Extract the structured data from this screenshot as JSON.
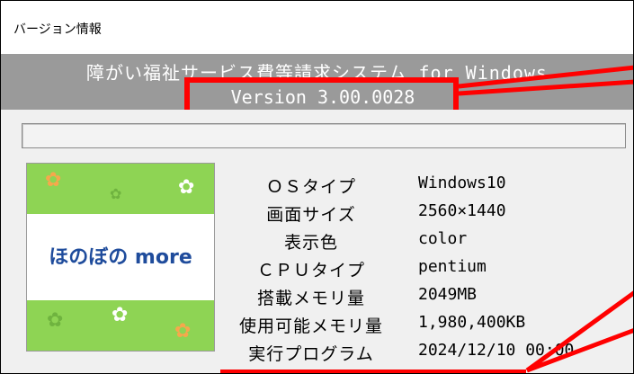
{
  "window": {
    "title": "バージョン情報"
  },
  "header": {
    "app_name": "障がい福祉サービス費等請求システム for Windows",
    "version": "Version 3.00.0028"
  },
  "logo": {
    "brand": "ほのぼの more"
  },
  "info_rows": [
    {
      "label": "ＯＳタイプ",
      "value": "Windows10"
    },
    {
      "label": "画面サイズ",
      "value": "2560×1440"
    },
    {
      "label": "表示色",
      "value": "color"
    },
    {
      "label": "ＣＰＵタイプ",
      "value": "pentium"
    },
    {
      "label": "搭載メモリ量",
      "value": "2049MB"
    },
    {
      "label": "使用可能メモリ量",
      "value": "1,980,400KB"
    },
    {
      "label": "実行プログラム",
      "value": "2024/12/10 00:00"
    }
  ],
  "colors": {
    "header_band": "#9a9a9a",
    "highlight": "#ff0000",
    "logo_green": "#8ed454",
    "logo_brand": "#1f4c9c"
  }
}
